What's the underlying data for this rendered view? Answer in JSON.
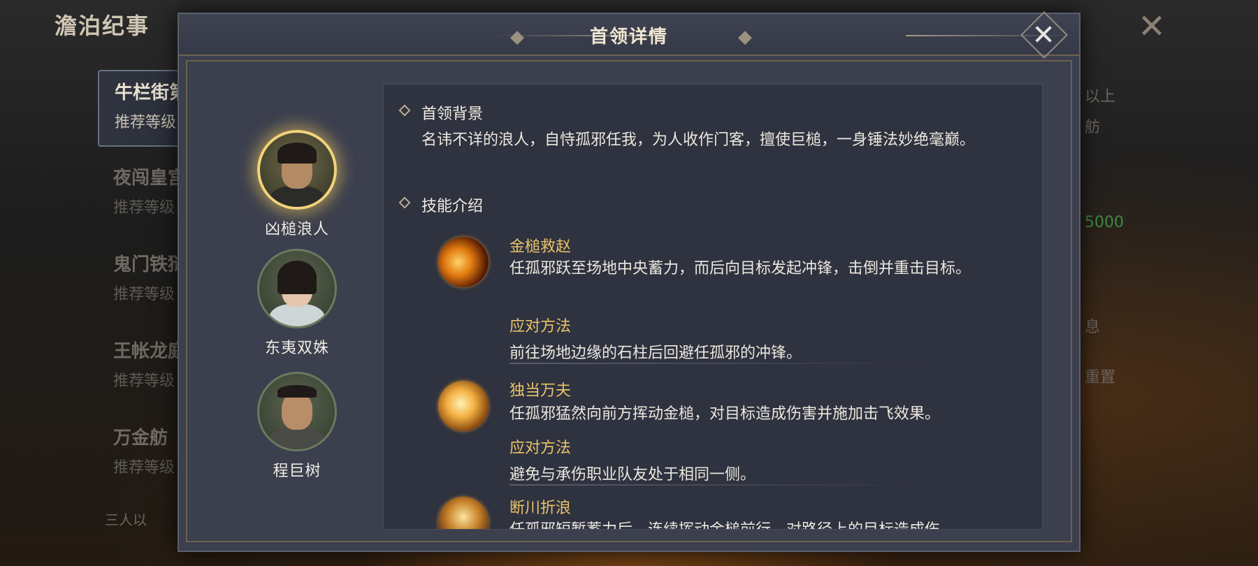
{
  "background": {
    "title": "澹泊纪事",
    "list": [
      {
        "name": "牛栏街第",
        "level": "推荐等级"
      },
      {
        "name": "夜闯皇宫",
        "level": "推荐等级"
      },
      {
        "name": "鬼门铁狱",
        "level": "推荐等级"
      },
      {
        "name": "王帐龙庭",
        "level": "推荐等级"
      },
      {
        "name": "万金舫",
        "level": "推荐等级"
      }
    ],
    "note": "三人以",
    "right": [
      "以上",
      "舫",
      "5000",
      "息",
      "重置"
    ]
  },
  "modal": {
    "title": "首领详情",
    "close_icon": "close-icon"
  },
  "bosses": [
    {
      "name": "凶槌浪人",
      "selected": true
    },
    {
      "name": "东夷双姝",
      "selected": false
    },
    {
      "name": "程巨树",
      "selected": false
    }
  ],
  "background_section": {
    "heading": "首领背景",
    "text": "名讳不详的浪人，自恃孤邪任我，为人收作门客，擅使巨槌，一身锤法妙绝毫巅。"
  },
  "skills_section": {
    "heading": "技能介绍",
    "skills": [
      {
        "name": "金槌救赵",
        "desc": "任孤邪跃至场地中央蓄力，而后向目标发起冲锋，击倒并重击目标。",
        "response_title": "应对方法",
        "response": "前往场地边缘的石柱后回避任孤邪的冲锋。"
      },
      {
        "name": "独当万夫",
        "desc": "任孤邪猛然向前方挥动金槌，对目标造成伤害并施加击飞效果。",
        "response_title": "应对方法",
        "response": "避免与承伤职业队友处于相同一侧。"
      },
      {
        "name": "断川折浪",
        "desc": "任孤邪短暂蓄力后，连续挥动金槌前行，对路径上的目标造成伤"
      }
    ]
  },
  "colors": {
    "accent_gold": "#e8c46a",
    "panel_bg": "#2f323f",
    "modal_bg": "#3b3f4e"
  }
}
